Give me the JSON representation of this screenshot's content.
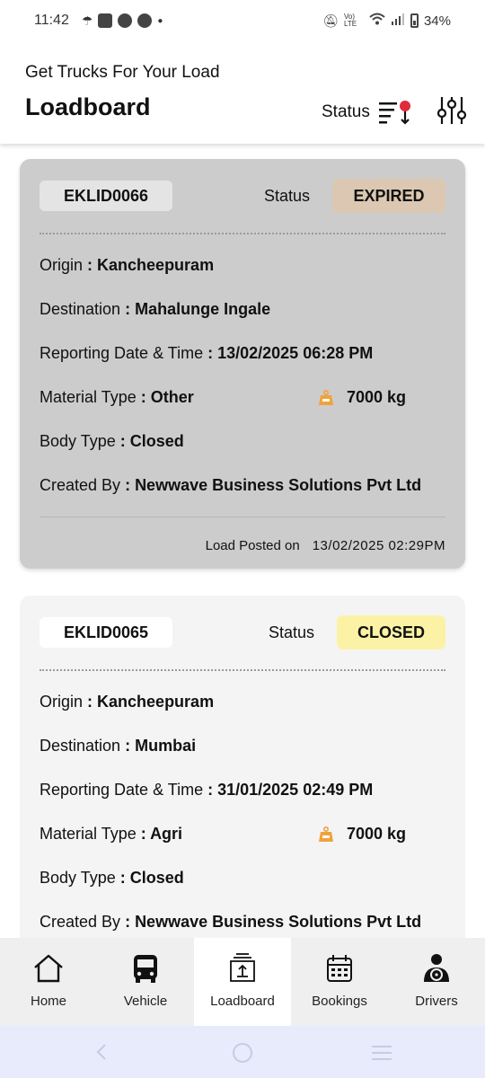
{
  "statusbar": {
    "time": "11:42",
    "battery": "34%",
    "network": "Vo) LTE"
  },
  "header": {
    "subtitle": "Get Trucks For Your Load",
    "title": "Loadboard",
    "status_filter_label": "Status"
  },
  "labels": {
    "status": "Status",
    "origin": "Origin",
    "destination": "Destination",
    "reporting": "Reporting Date & Time",
    "material": "Material Type",
    "body": "Body Type",
    "created_by": "Created By",
    "posted_on": "Load Posted on",
    "sep": ":"
  },
  "loads": [
    {
      "id": "EKLID0066",
      "status": "EXPIRED",
      "status_color": "#dcc8b2",
      "origin": "Kancheepuram",
      "destination": "Mahalunge Ingale",
      "reporting": "13/02/2025 06:28 PM",
      "material": "Other",
      "weight": "7000 kg",
      "body": "Closed",
      "created_by": "Newwave Business Solutions Pvt Ltd",
      "posted_on": "13/02/2025 02:29PM"
    },
    {
      "id": "EKLID0065",
      "status": "CLOSED",
      "status_color": "#fbf2a6",
      "origin": "Kancheepuram",
      "destination": "Mumbai",
      "reporting": "31/01/2025 02:49 PM",
      "material": "Agri",
      "weight": "7000 kg",
      "body": "Closed",
      "created_by": "Newwave Business Solutions Pvt Ltd"
    }
  ],
  "nav": [
    {
      "label": "Home",
      "icon": "home-icon"
    },
    {
      "label": "Vehicle",
      "icon": "bus-icon"
    },
    {
      "label": "Loadboard",
      "icon": "loadboard-icon",
      "active": true
    },
    {
      "label": "Bookings",
      "icon": "calendar-icon"
    },
    {
      "label": "Drivers",
      "icon": "driver-icon"
    }
  ],
  "colors": {
    "weight_icon": "#f0a23a",
    "filter_dot": "#e02b3b",
    "active_nav_bg": "#ffffff"
  }
}
